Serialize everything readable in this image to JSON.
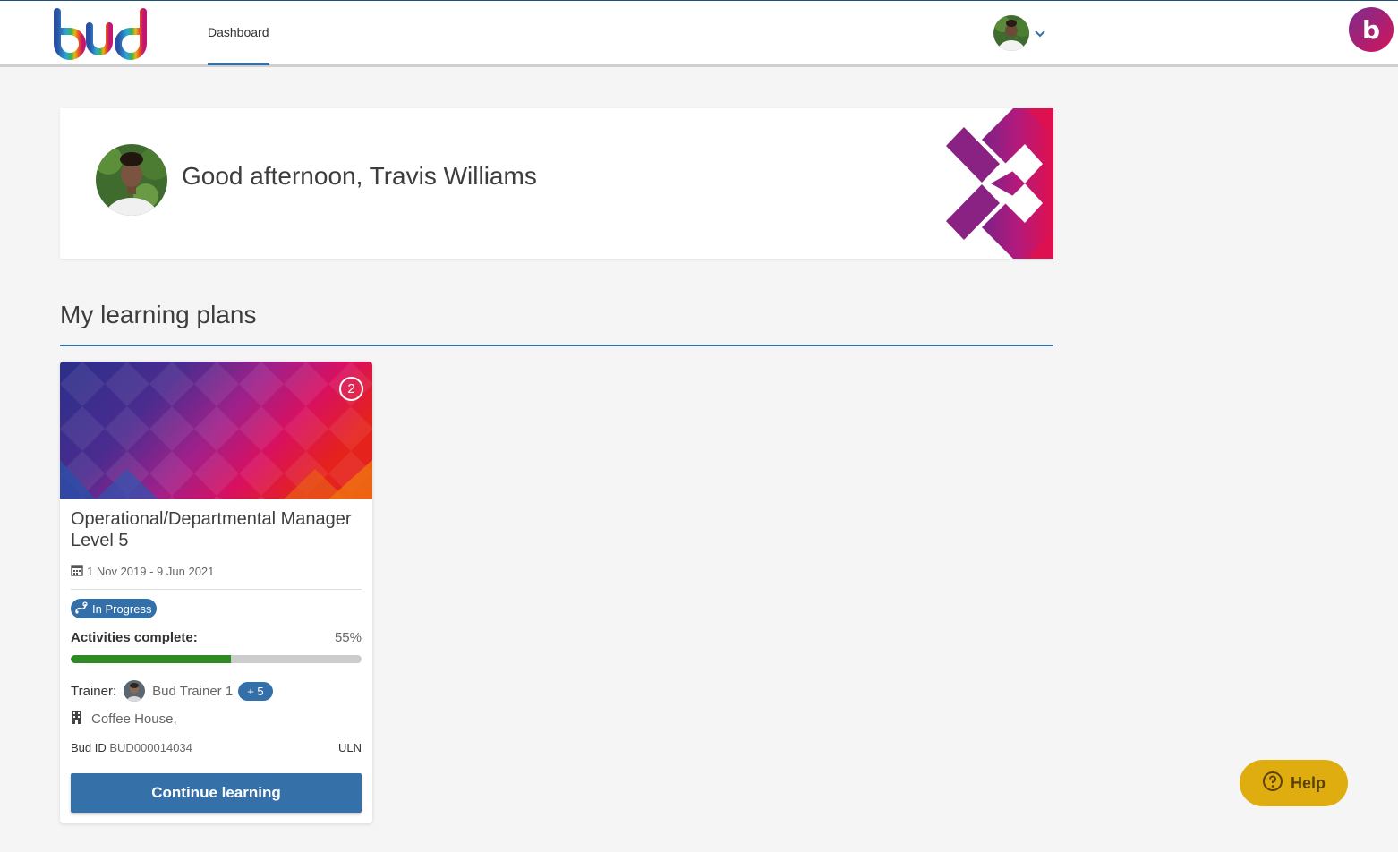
{
  "header": {
    "logo_text": "bud",
    "nav_tab": "Dashboard",
    "brand_badge": "b"
  },
  "welcome": {
    "greeting": "Good afternoon, Travis Williams"
  },
  "section": {
    "title": "My learning plans"
  },
  "plans": [
    {
      "count": "2",
      "title": "Operational/Departmental Manager Level 5",
      "dates": "1 Nov 2019 - 9 Jun 2021",
      "status": "In Progress",
      "activities_label": "Activities complete:",
      "activities_pct_text": "55%",
      "activities_pct": 55,
      "trainer_label": "Trainer:",
      "trainer_name": "Bud Trainer 1",
      "trainer_more": "+ 5",
      "employer": "Coffee House,",
      "bud_id_label": "Bud ID",
      "bud_id": "BUD000014034",
      "uln_label": "ULN",
      "cta": "Continue learning"
    }
  ],
  "help": {
    "label": "Help"
  },
  "colors": {
    "primary": "#336fa8",
    "progress": "#2e8b22",
    "help": "#e0ad10",
    "accent_magenta": "#c4166e"
  },
  "icons": [
    "calendar-icon",
    "status-icon",
    "building-icon",
    "chevron-down-icon",
    "help-icon"
  ]
}
